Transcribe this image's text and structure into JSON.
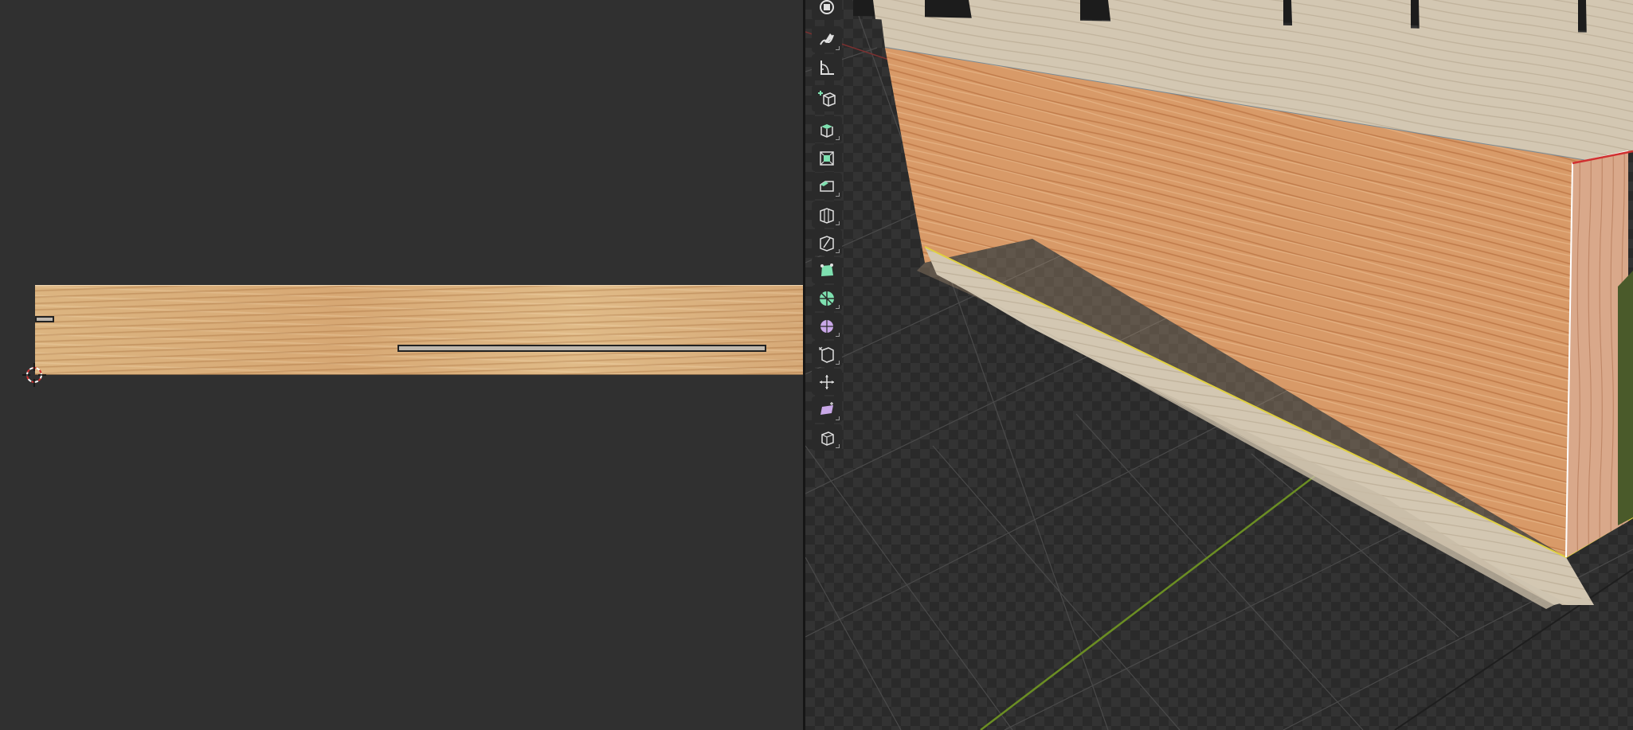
{
  "uv_editor": {
    "background_color": "#303030",
    "island_texture": "wood-grain"
  },
  "viewport": {
    "grid_color": "#5a5a5a",
    "y_axis_color": "#6b8e23",
    "selection_edge_color": "#e0d040",
    "active_edge_color": "#d03030"
  },
  "toolbar": {
    "tools": [
      {
        "name": "select-box-icon"
      },
      {
        "name": "annotate-icon"
      },
      {
        "name": "measure-icon"
      },
      {
        "name": "add-cube-icon"
      },
      {
        "name": "extrude-region-icon"
      },
      {
        "name": "inset-faces-icon"
      },
      {
        "name": "bevel-icon"
      },
      {
        "name": "loop-cut-icon"
      },
      {
        "name": "knife-icon"
      },
      {
        "name": "poly-build-icon"
      },
      {
        "name": "spin-icon"
      },
      {
        "name": "smooth-icon"
      },
      {
        "name": "edge-slide-icon"
      },
      {
        "name": "shrink-fatten-icon"
      },
      {
        "name": "shear-icon"
      },
      {
        "name": "rip-region-icon"
      }
    ]
  }
}
